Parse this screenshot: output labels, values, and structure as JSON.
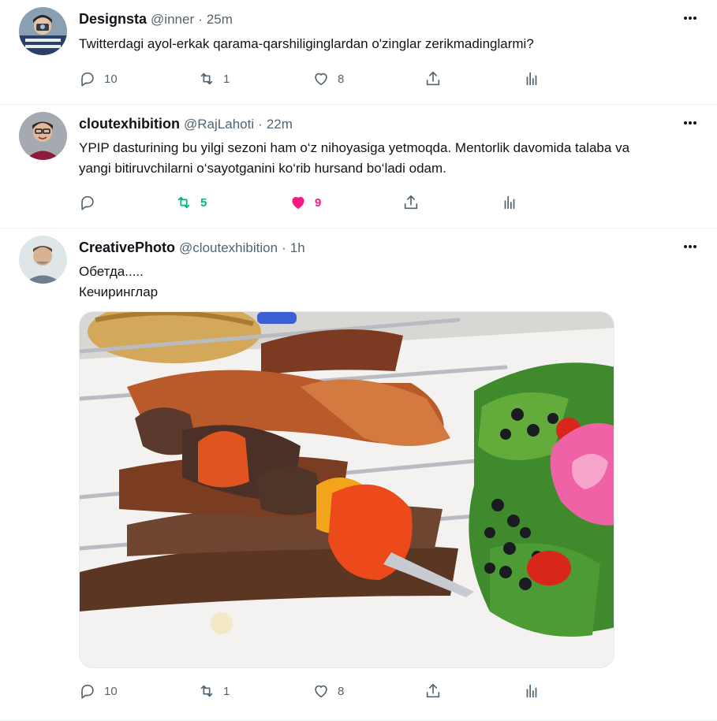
{
  "tweets": [
    {
      "display_name": "Designsta",
      "handle": "@inner",
      "time": "25m",
      "text_lines": [
        "Twitterdagi ayol-erkak qarama-qarshiliginglardan o'zinglar zerikmadinglarmi?"
      ],
      "replies": "10",
      "retweets": "1",
      "likes": "8",
      "retweeted": false,
      "liked": false
    },
    {
      "display_name": "cloutexhibition",
      "handle": "@RajLahoti",
      "time": "22m",
      "text_lines": [
        "YPIP dasturining bu yilgi sezoni ham o‘z nihoyasiga yetmoqda. Mentorlik davomida talaba va",
        "yangi bitiruvchilarni o‘sayotganini ko‘rib hursand bo‘ladi odam."
      ],
      "replies": "",
      "retweets": "5",
      "likes": "9",
      "retweeted": true,
      "liked": true
    },
    {
      "display_name": "CreativePhoto",
      "handle": "@cloutexhibition",
      "time": "1h",
      "text_lines": [
        "Обетда.....",
        "Кечиринглар"
      ],
      "replies": "10",
      "retweets": "1",
      "likes": "8",
      "retweeted": false,
      "liked": false
    }
  ],
  "separator": "·",
  "colors": {
    "text": "#0f1419",
    "secondary": "#536471",
    "retweet_active": "#00ba7c",
    "like_active": "#f91880",
    "border": "#eff3f4"
  },
  "icons": [
    "reply-icon",
    "retweet-icon",
    "like-icon",
    "share-icon",
    "analytics-icon",
    "more-icon"
  ]
}
